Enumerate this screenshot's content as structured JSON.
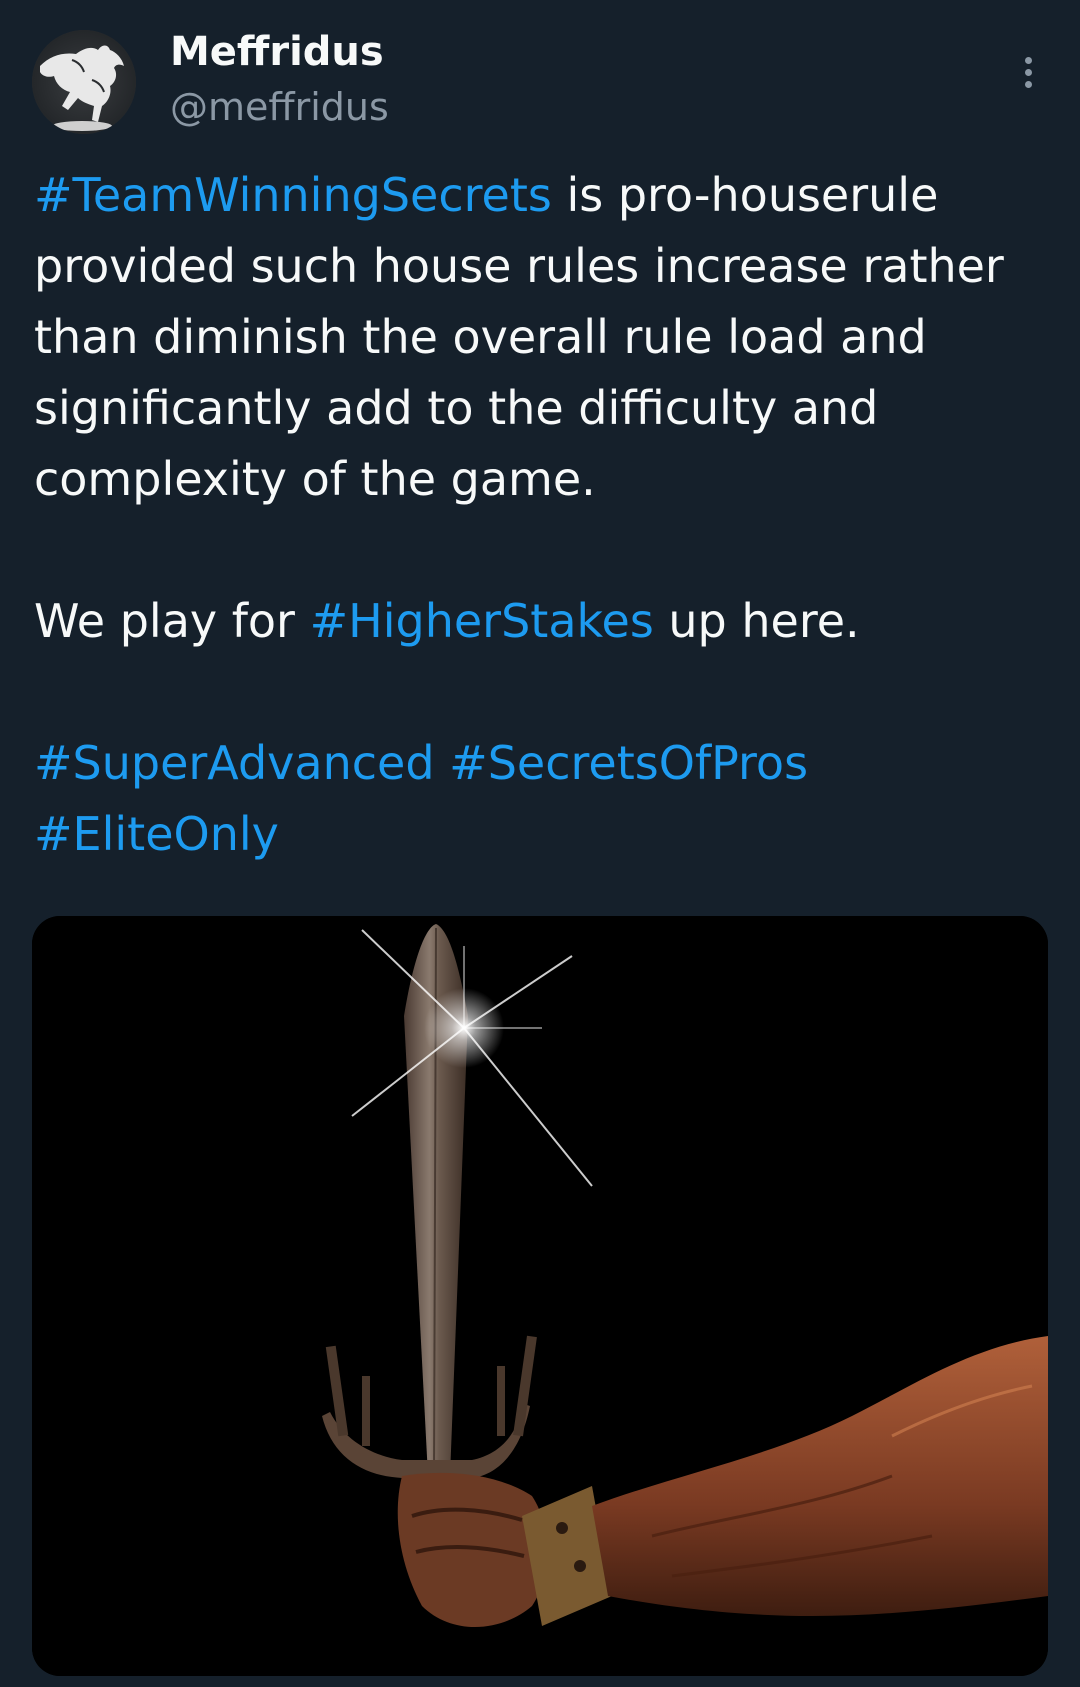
{
  "author": {
    "display_name": "Meffridus",
    "handle": "@meffridus",
    "avatar_icon": "horse-avatar-icon"
  },
  "menu": {
    "icon": "more-vertical-icon"
  },
  "tweet": {
    "line1_hashtag": "#TeamWinningSecrets",
    "line1_rest": " is pro-houserule provided such house rules increase rather than diminish the overall rule load and significantly add to the difficulty and complexity of the game.",
    "para2_pre": "We play for ",
    "para2_hashtag": "#HigherStakes",
    "para2_post": " up here.",
    "tags": [
      "#SuperAdvanced",
      "#SecretsOfPros",
      "#EliteOnly"
    ]
  },
  "media": {
    "icon": "sword-artwork-image"
  },
  "colors": {
    "background": "#15202b",
    "text": "#f7f9f9",
    "secondary": "#8b98a5",
    "link": "#1d9bf0"
  }
}
